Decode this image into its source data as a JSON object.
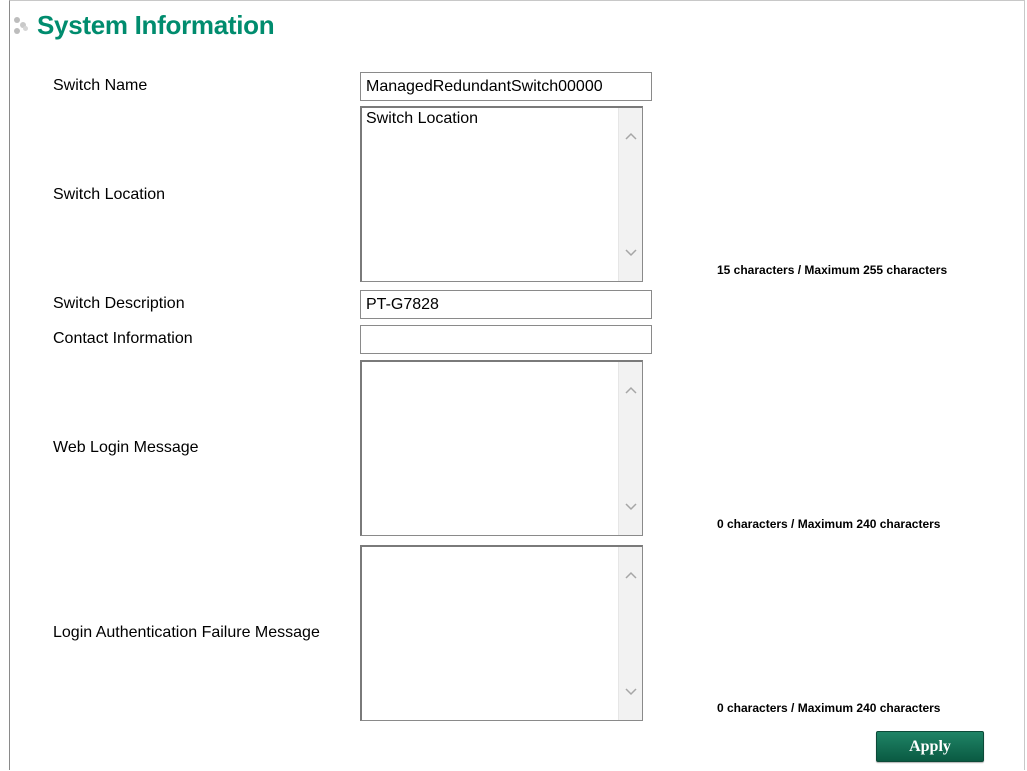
{
  "page": {
    "title": "System Information"
  },
  "fields": {
    "switch_name": {
      "label": "Switch Name",
      "value": "ManagedRedundantSwitch00000"
    },
    "switch_location": {
      "label": "Switch Location",
      "value": "Switch Location",
      "counter": "15 characters / Maximum 255 characters"
    },
    "switch_description": {
      "label": "Switch Description",
      "value": "PT-G7828"
    },
    "contact_information": {
      "label": "Contact Information",
      "value": ""
    },
    "web_login_message": {
      "label": "Web Login Message",
      "value": "",
      "counter": "0 characters / Maximum 240 characters"
    },
    "login_failure_message": {
      "label": "Login Authentication Failure Message",
      "value": "",
      "counter": "0 characters / Maximum 240 characters"
    }
  },
  "actions": {
    "apply_label": "Apply"
  },
  "icons": {
    "title_decoration": "dots-icon",
    "scroll_up": "chevron-up-icon",
    "scroll_down": "chevron-down-icon"
  },
  "colors": {
    "title": "#008c6e",
    "apply_button": "#0f6b50"
  }
}
